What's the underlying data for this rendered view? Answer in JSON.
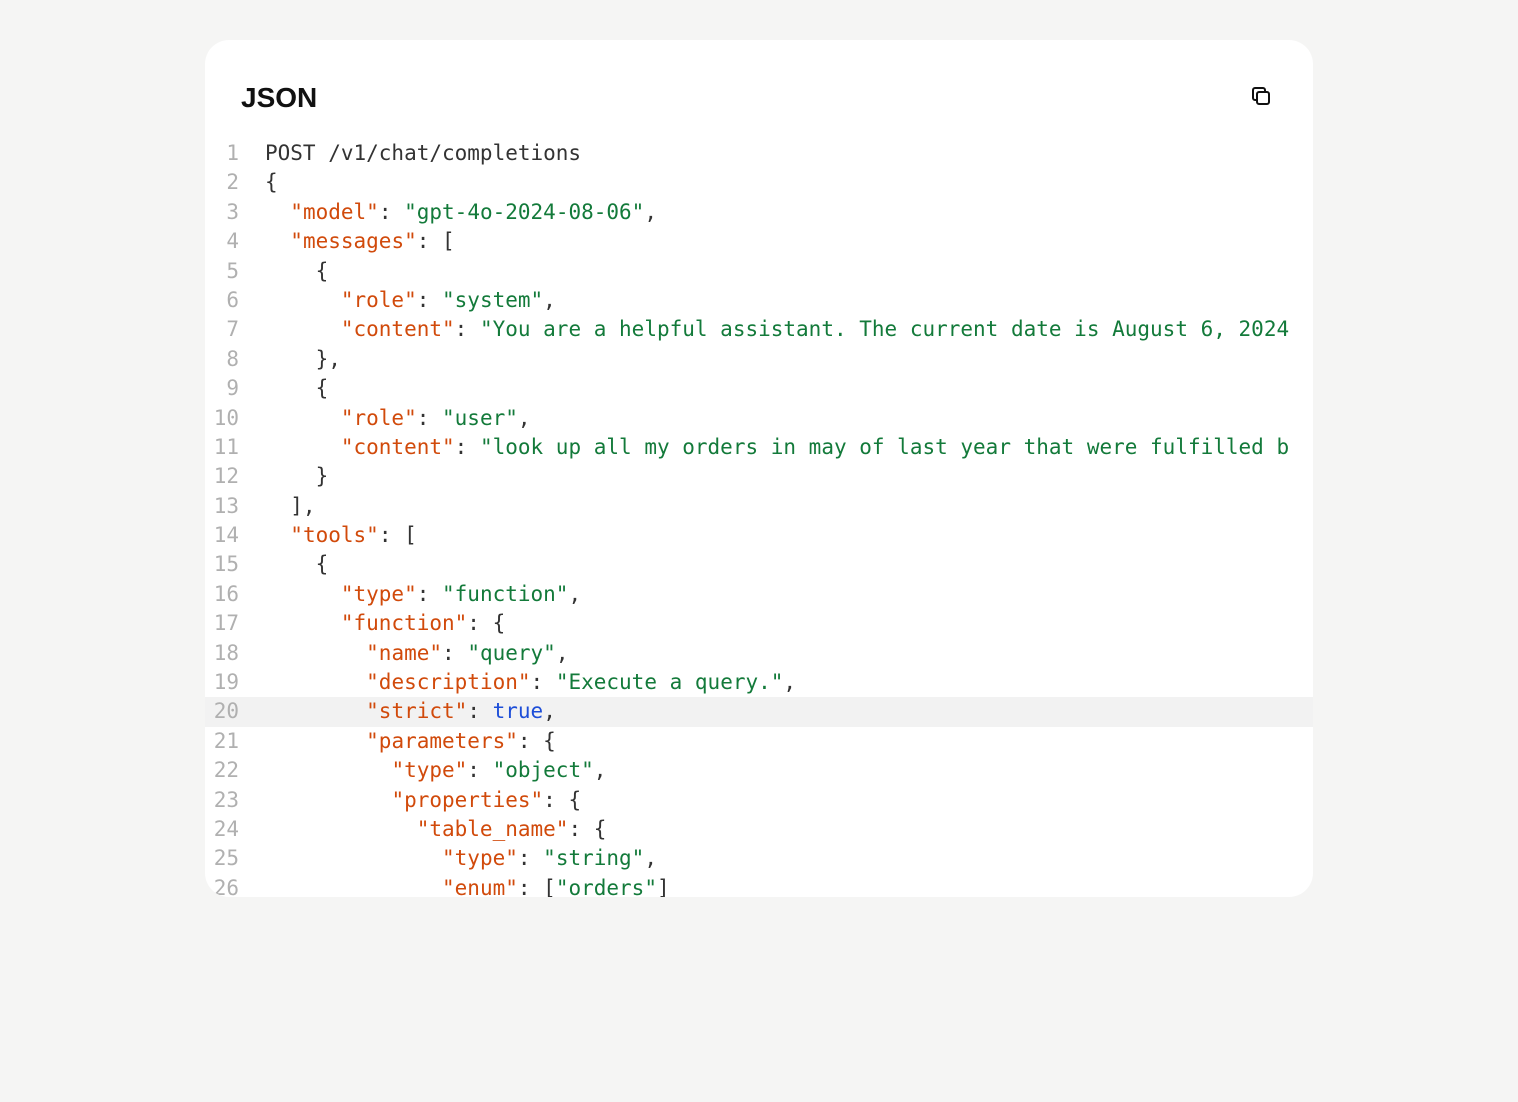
{
  "header": {
    "title": "JSON"
  },
  "colors": {
    "key": "#d14a0b",
    "string": "#137a3a",
    "bool": "#1d4ed8",
    "gutter": "#b0b0b0",
    "highlight": "#f2f2f2"
  },
  "highlight_line": 20,
  "lines": [
    {
      "n": 1,
      "tokens": [
        {
          "t": "POST /v1/chat/completions",
          "c": "p"
        }
      ]
    },
    {
      "n": 2,
      "tokens": [
        {
          "t": "{",
          "c": "p"
        }
      ]
    },
    {
      "n": 3,
      "tokens": [
        {
          "t": "  ",
          "c": "p"
        },
        {
          "t": "\"model\"",
          "c": "k"
        },
        {
          "t": ": ",
          "c": "p"
        },
        {
          "t": "\"gpt-4o-2024-08-06\"",
          "c": "s"
        },
        {
          "t": ",",
          "c": "p"
        }
      ]
    },
    {
      "n": 4,
      "tokens": [
        {
          "t": "  ",
          "c": "p"
        },
        {
          "t": "\"messages\"",
          "c": "k"
        },
        {
          "t": ": [",
          "c": "p"
        }
      ]
    },
    {
      "n": 5,
      "tokens": [
        {
          "t": "    {",
          "c": "p"
        }
      ]
    },
    {
      "n": 6,
      "tokens": [
        {
          "t": "      ",
          "c": "p"
        },
        {
          "t": "\"role\"",
          "c": "k"
        },
        {
          "t": ": ",
          "c": "p"
        },
        {
          "t": "\"system\"",
          "c": "s"
        },
        {
          "t": ",",
          "c": "p"
        }
      ]
    },
    {
      "n": 7,
      "tokens": [
        {
          "t": "      ",
          "c": "p"
        },
        {
          "t": "\"content\"",
          "c": "k"
        },
        {
          "t": ": ",
          "c": "p"
        },
        {
          "t": "\"You are a helpful assistant. The current date is August 6, 2024",
          "c": "s"
        }
      ]
    },
    {
      "n": 8,
      "tokens": [
        {
          "t": "    },",
          "c": "p"
        }
      ]
    },
    {
      "n": 9,
      "tokens": [
        {
          "t": "    {",
          "c": "p"
        }
      ]
    },
    {
      "n": 10,
      "tokens": [
        {
          "t": "      ",
          "c": "p"
        },
        {
          "t": "\"role\"",
          "c": "k"
        },
        {
          "t": ": ",
          "c": "p"
        },
        {
          "t": "\"user\"",
          "c": "s"
        },
        {
          "t": ",",
          "c": "p"
        }
      ]
    },
    {
      "n": 11,
      "tokens": [
        {
          "t": "      ",
          "c": "p"
        },
        {
          "t": "\"content\"",
          "c": "k"
        },
        {
          "t": ": ",
          "c": "p"
        },
        {
          "t": "\"look up all my orders in may of last year that were fulfilled b",
          "c": "s"
        }
      ]
    },
    {
      "n": 12,
      "tokens": [
        {
          "t": "    }",
          "c": "p"
        }
      ]
    },
    {
      "n": 13,
      "tokens": [
        {
          "t": "  ],",
          "c": "p"
        }
      ]
    },
    {
      "n": 14,
      "tokens": [
        {
          "t": "  ",
          "c": "p"
        },
        {
          "t": "\"tools\"",
          "c": "k"
        },
        {
          "t": ": [",
          "c": "p"
        }
      ]
    },
    {
      "n": 15,
      "tokens": [
        {
          "t": "    {",
          "c": "p"
        }
      ]
    },
    {
      "n": 16,
      "tokens": [
        {
          "t": "      ",
          "c": "p"
        },
        {
          "t": "\"type\"",
          "c": "k"
        },
        {
          "t": ": ",
          "c": "p"
        },
        {
          "t": "\"function\"",
          "c": "s"
        },
        {
          "t": ",",
          "c": "p"
        }
      ]
    },
    {
      "n": 17,
      "tokens": [
        {
          "t": "      ",
          "c": "p"
        },
        {
          "t": "\"function\"",
          "c": "k"
        },
        {
          "t": ": {",
          "c": "p"
        }
      ]
    },
    {
      "n": 18,
      "tokens": [
        {
          "t": "        ",
          "c": "p"
        },
        {
          "t": "\"name\"",
          "c": "k"
        },
        {
          "t": ": ",
          "c": "p"
        },
        {
          "t": "\"query\"",
          "c": "s"
        },
        {
          "t": ",",
          "c": "p"
        }
      ]
    },
    {
      "n": 19,
      "tokens": [
        {
          "t": "        ",
          "c": "p"
        },
        {
          "t": "\"description\"",
          "c": "k"
        },
        {
          "t": ": ",
          "c": "p"
        },
        {
          "t": "\"Execute a query.\"",
          "c": "s"
        },
        {
          "t": ",",
          "c": "p"
        }
      ]
    },
    {
      "n": 20,
      "tokens": [
        {
          "t": "        ",
          "c": "p"
        },
        {
          "t": "\"strict\"",
          "c": "k"
        },
        {
          "t": ": ",
          "c": "p"
        },
        {
          "t": "true",
          "c": "b"
        },
        {
          "t": ",",
          "c": "p"
        }
      ]
    },
    {
      "n": 21,
      "tokens": [
        {
          "t": "        ",
          "c": "p"
        },
        {
          "t": "\"parameters\"",
          "c": "k"
        },
        {
          "t": ": {",
          "c": "p"
        }
      ]
    },
    {
      "n": 22,
      "tokens": [
        {
          "t": "          ",
          "c": "p"
        },
        {
          "t": "\"type\"",
          "c": "k"
        },
        {
          "t": ": ",
          "c": "p"
        },
        {
          "t": "\"object\"",
          "c": "s"
        },
        {
          "t": ",",
          "c": "p"
        }
      ]
    },
    {
      "n": 23,
      "tokens": [
        {
          "t": "          ",
          "c": "p"
        },
        {
          "t": "\"properties\"",
          "c": "k"
        },
        {
          "t": ": {",
          "c": "p"
        }
      ]
    },
    {
      "n": 24,
      "tokens": [
        {
          "t": "            ",
          "c": "p"
        },
        {
          "t": "\"table_name\"",
          "c": "k"
        },
        {
          "t": ": {",
          "c": "p"
        }
      ]
    },
    {
      "n": 25,
      "tokens": [
        {
          "t": "              ",
          "c": "p"
        },
        {
          "t": "\"type\"",
          "c": "k"
        },
        {
          "t": ": ",
          "c": "p"
        },
        {
          "t": "\"string\"",
          "c": "s"
        },
        {
          "t": ",",
          "c": "p"
        }
      ]
    },
    {
      "n": 26,
      "tokens": [
        {
          "t": "              ",
          "c": "p"
        },
        {
          "t": "\"enum\"",
          "c": "k"
        },
        {
          "t": ": [",
          "c": "p"
        },
        {
          "t": "\"orders\"",
          "c": "s"
        },
        {
          "t": "]",
          "c": "p"
        }
      ]
    }
  ]
}
